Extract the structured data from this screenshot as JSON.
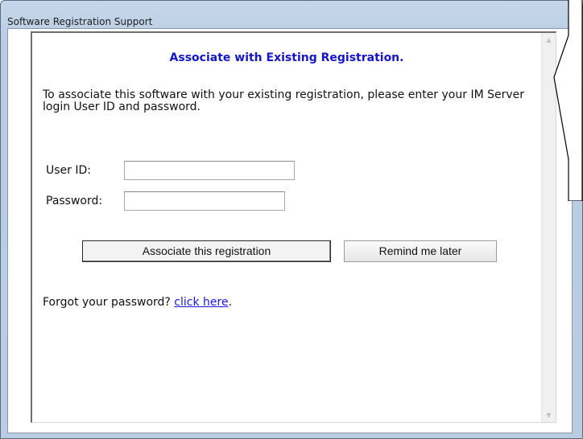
{
  "window": {
    "title": "Software Registration Support"
  },
  "page": {
    "heading": "Associate with Existing Registration.",
    "intro": "To associate this software with your existing registration, please enter your IM Server login User ID and password."
  },
  "form": {
    "user_id_label": "User ID:",
    "user_id_value": "",
    "password_label": "Password:",
    "password_value": ""
  },
  "buttons": {
    "associate_label": "Associate this registration",
    "remind_label": "Remind me later"
  },
  "forgot": {
    "prefix": "Forgot your password? ",
    "link_text": "click here",
    "suffix": "."
  },
  "scrollbar": {
    "up_icon": "triangle-up-icon",
    "down_icon": "triangle-down-icon"
  },
  "colors": {
    "heading": "#1515c8",
    "link": "#1a1ae0",
    "window_frame": "#b9cce2"
  }
}
